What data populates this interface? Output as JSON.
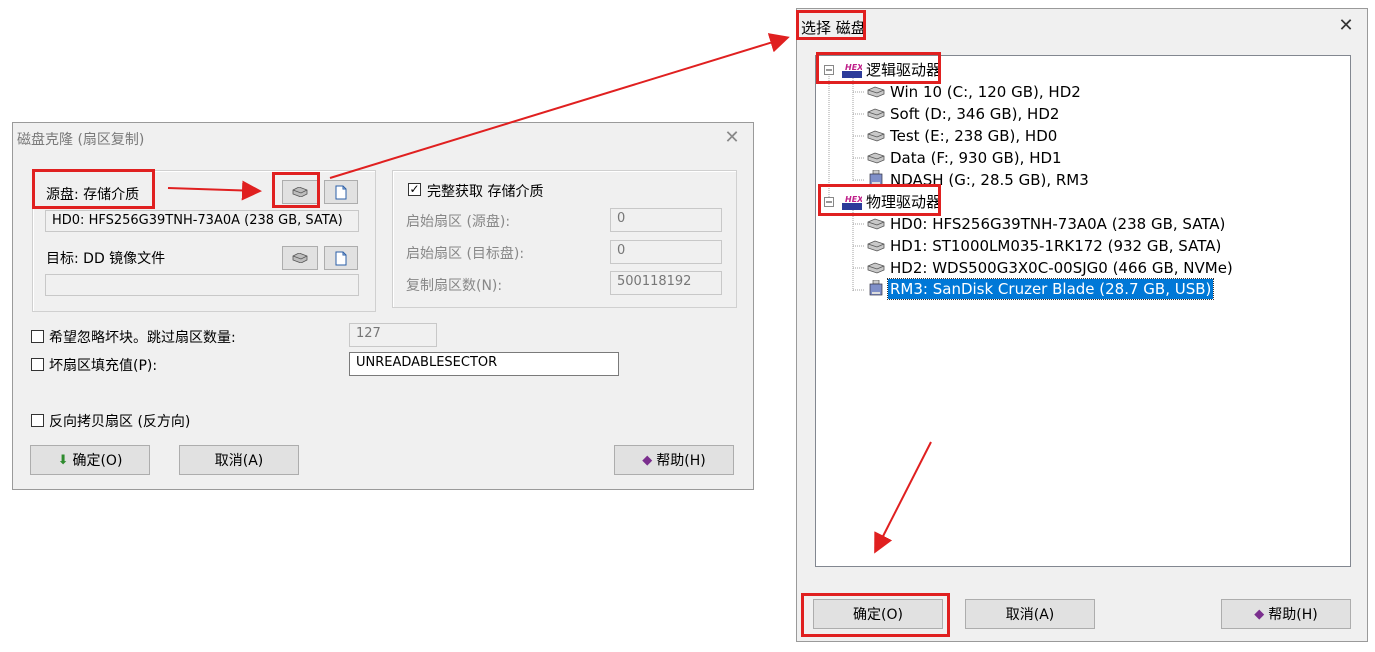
{
  "clone_dialog": {
    "title": "磁盘克隆 (扇区复制)",
    "source_label": "源盘: 存储介质",
    "source_value": "HD0: HFS256G39TNH-73A0A (238 GB, SATA)",
    "target_label": "目标: DD 镜像文件",
    "target_value": "",
    "full_acquire_label": "完整获取 存储介质",
    "start_sector_src_label": "启始扇区 (源盘):",
    "start_sector_src_value": "0",
    "start_sector_dst_label": "启始扇区 (目标盘):",
    "start_sector_dst_value": "0",
    "copy_count_label": "复制扇区数(N):",
    "copy_count_value": "500118192",
    "ignore_bad_label": "希望忽略坏块。跳过扇区数量:",
    "ignore_bad_value": "127",
    "fill_bad_label": "坏扇区填充值(P):",
    "fill_bad_value": "UNREADABLESECTOR",
    "reverse_label": "反向拷贝扇区 (反方向)",
    "ok_label": "确定(O)",
    "cancel_label": "取消(A)",
    "help_label": "帮助(H)"
  },
  "select_dialog": {
    "title": "选择 磁盘",
    "logical_group": "逻辑驱动器",
    "logical_items": [
      "Win 10 (C:, 120 GB), HD2",
      "Soft (D:, 346 GB), HD2",
      "Test (E:, 238 GB), HD0",
      "Data (F:, 930 GB), HD1",
      "NDASH (G:, 28.5 GB), RM3"
    ],
    "physical_group": "物理驱动器",
    "physical_items": [
      "HD0: HFS256G39TNH-73A0A (238 GB, SATA)",
      "HD1: ST1000LM035-1RK172 (932 GB, SATA)",
      "HD2: WDS500G3X0C-00SJG0 (466 GB, NVMe)",
      "RM3: SanDisk Cruzer Blade (28.7 GB, USB)"
    ],
    "ok_label": "确定(O)",
    "cancel_label": "取消(A)",
    "help_label": "帮助(H)",
    "hex_icon_text": "HEX"
  },
  "colors": {
    "annotation_red": "#e02020",
    "selection_blue": "#0078d7"
  }
}
